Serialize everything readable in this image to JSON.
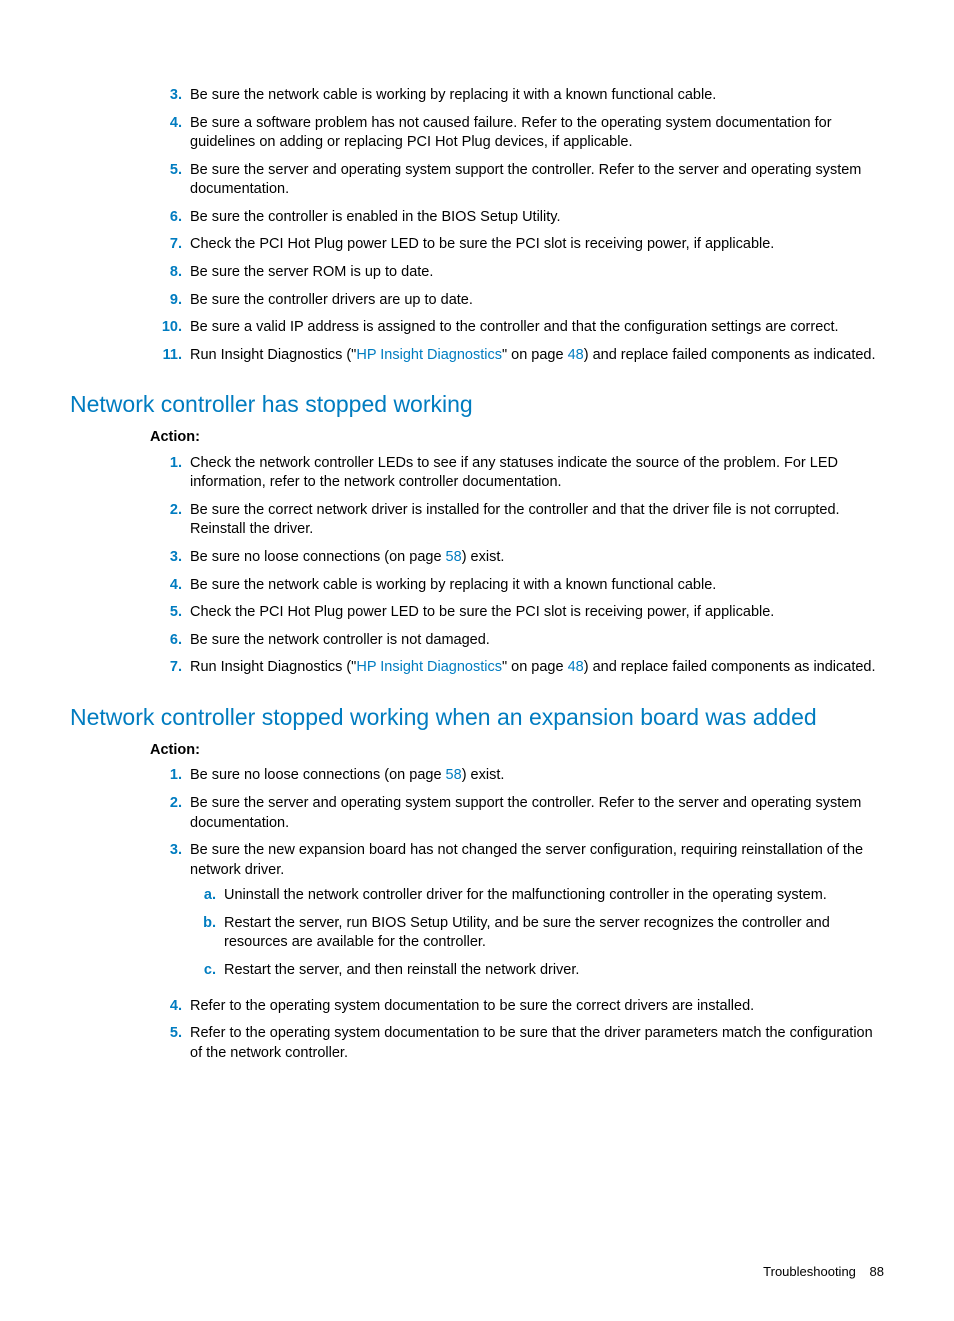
{
  "section1": {
    "items": [
      {
        "n": "3.",
        "t": "Be sure the network cable is working by replacing it with a known functional cable."
      },
      {
        "n": "4.",
        "t": "Be sure a software problem has not caused failure. Refer to the operating system documentation for guidelines on adding or replacing PCI Hot Plug devices, if applicable."
      },
      {
        "n": "5.",
        "t": "Be sure the server and operating system support the controller. Refer to the server and operating system documentation."
      },
      {
        "n": "6.",
        "t": "Be sure the controller is enabled in the BIOS Setup Utility."
      },
      {
        "n": "7.",
        "t": "Check the PCI Hot Plug power LED to be sure the PCI slot is receiving power, if applicable."
      },
      {
        "n": "8.",
        "t": "Be sure the server ROM is up to date."
      },
      {
        "n": "9.",
        "t": "Be sure the controller drivers are up to date."
      },
      {
        "n": "10.",
        "t": "Be sure a valid IP address is assigned to the controller and that the configuration settings are correct."
      },
      {
        "n": "11.",
        "pre": "Run Insight Diagnostics (\"",
        "link": "HP Insight Diagnostics",
        "mid": "\" on page ",
        "page": "48",
        "post": ") and replace failed components as indicated."
      }
    ]
  },
  "section2": {
    "heading": "Network controller has stopped working",
    "action": "Action",
    "items": [
      {
        "n": "1.",
        "t": "Check the network controller LEDs to see if any statuses indicate the source of the problem. For LED information, refer to the network controller documentation."
      },
      {
        "n": "2.",
        "t": "Be sure the correct network driver is installed for the controller and that the driver file is not corrupted. Reinstall the driver."
      },
      {
        "n": "3.",
        "pre": "Be sure no loose connections (on page ",
        "page": "58",
        "post": ") exist."
      },
      {
        "n": "4.",
        "t": "Be sure the network cable is working by replacing it with a known functional cable."
      },
      {
        "n": "5.",
        "t": "Check the PCI Hot Plug power LED to be sure the PCI slot is receiving power, if applicable."
      },
      {
        "n": "6.",
        "t": "Be sure the network controller is not damaged."
      },
      {
        "n": "7.",
        "pre": "Run Insight Diagnostics (\"",
        "link": "HP Insight Diagnostics",
        "mid": "\" on page ",
        "page": "48",
        "post": ") and replace failed components as indicated."
      }
    ]
  },
  "section3": {
    "heading": "Network controller stopped working when an expansion board was added",
    "action": "Action",
    "items": [
      {
        "n": "1.",
        "pre": "Be sure no loose connections (on page ",
        "page": "58",
        "post": ") exist."
      },
      {
        "n": "2.",
        "t": "Be sure the server and operating system support the controller. Refer to the server and operating system documentation."
      },
      {
        "n": "3.",
        "t": "Be sure the new expansion board has not changed the server configuration, requiring reinstallation of the network driver.",
        "sub": [
          {
            "n": "a.",
            "t": "Uninstall the network controller driver for the malfunctioning controller in the operating system."
          },
          {
            "n": "b.",
            "t": "Restart the server, run BIOS Setup Utility, and be sure the server recognizes the controller and resources are available for the controller."
          },
          {
            "n": "c.",
            "t": "Restart the server, and then reinstall the network driver."
          }
        ]
      },
      {
        "n": "4.",
        "t": "Refer to the operating system documentation to be sure the correct drivers are installed."
      },
      {
        "n": "5.",
        "t": "Refer to the operating system documentation to be sure that the driver parameters match the configuration of the network controller."
      }
    ]
  },
  "footer": {
    "label": "Troubleshooting",
    "page": "88"
  }
}
